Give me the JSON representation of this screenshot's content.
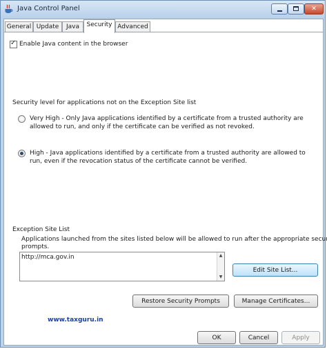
{
  "window": {
    "title": "Java Control Panel",
    "minimize_glyph": "",
    "close_glyph": "✕"
  },
  "tabs": [
    {
      "label": "General",
      "active": false
    },
    {
      "label": "Update",
      "active": false
    },
    {
      "label": "Java",
      "active": false
    },
    {
      "label": "Security",
      "active": true
    },
    {
      "label": "Advanced",
      "active": false
    }
  ],
  "security": {
    "enable_java": {
      "label": "Enable Java content in the browser",
      "checked": true,
      "check_glyph": "✓"
    },
    "level_heading": "Security level for applications not on the Exception Site list",
    "very_high": {
      "line1": "Very High - Only Java applications identified by a certificate from a trusted authority are",
      "line2": "allowed to run, and only if the certificate can be verified as not revoked.",
      "selected": false
    },
    "high": {
      "line1": "High - Java applications identified by a certificate from a trusted authority are allowed to",
      "line2": "run, even if the revocation status of the certificate cannot be verified.",
      "selected": true
    },
    "exception_heading": "Exception Site List",
    "exception_desc_line1": "Applications launched from the sites listed below will be allowed to run after the appropriate security",
    "exception_desc_line2": "prompts.",
    "sites": [
      "http://mca.gov.in"
    ],
    "scroll_up": "▲",
    "scroll_down": "▼",
    "edit_site_list_label": "Edit Site List...",
    "restore_prompts_label": "Restore Security Prompts",
    "manage_certs_label": "Manage Certificates..."
  },
  "footer": {
    "watermark": "www.taxguru.in",
    "ok_label": "OK",
    "cancel_label": "Cancel",
    "apply_label": "Apply"
  },
  "colors": {
    "frame": "#bcd3ea",
    "close_button": "#c5492c",
    "watermark": "#1c3ea8"
  }
}
